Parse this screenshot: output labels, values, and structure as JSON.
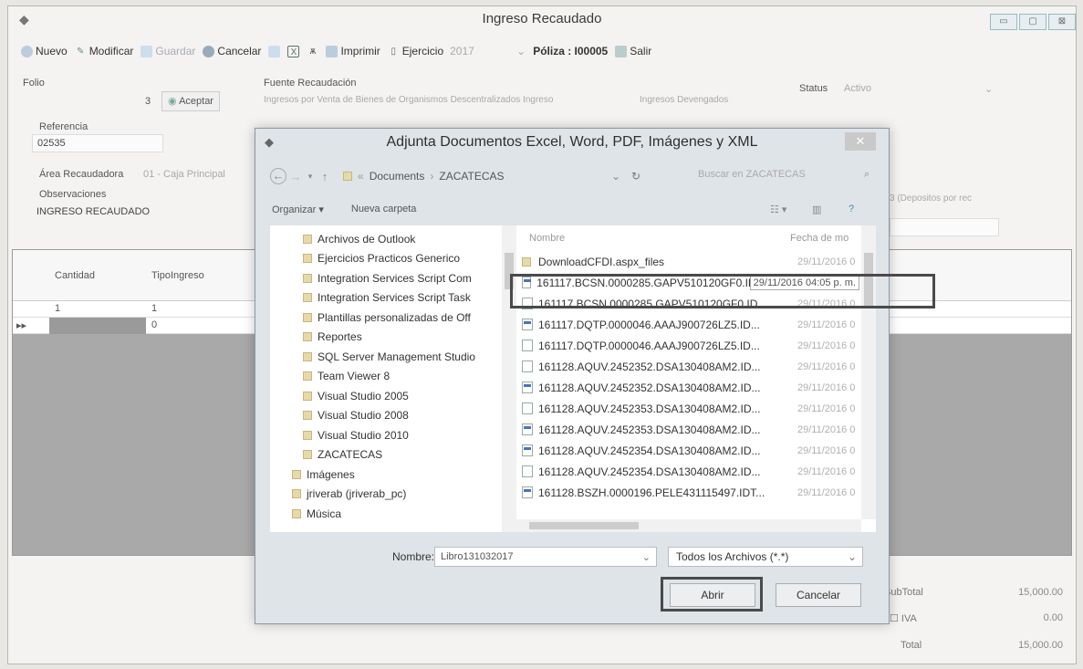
{
  "main": {
    "title": "Ingreso Recaudado",
    "toolbar": {
      "nuevo": "Nuevo",
      "modificar": "Modificar",
      "guardar": "Guardar",
      "cancelar": "Cancelar",
      "imprimir": "Imprimir",
      "ejercicio_label": "Ejercicio",
      "ejercicio_value": "2017",
      "poliza": "Póliza : I00005",
      "salir": "Salir"
    },
    "folio_label": "Folio",
    "folio_value": "3",
    "aceptar": "Aceptar",
    "fuente_label": "Fuente Recaudación",
    "fuente_value": "Ingresos por Venta de Bienes de Organismos Descentralizados Ingreso",
    "ingresos_devengados": "Ingresos Devengados",
    "status_label": "Status",
    "status_value": "Activo",
    "referencia_label": "Referencia",
    "referencia_value": "02535",
    "area_label": "Área Recaudadora",
    "area_value": "01 - Caja Principal",
    "observaciones_label": "Observaciones",
    "observaciones_value": "INGRESO RECAUDADO",
    "depositos_partial": "3 (Depositos por rec",
    "ref_partial": "02535",
    "grid": {
      "col_cantidad": "Cantidad",
      "col_tipo": "TipoIngreso",
      "row1": {
        "cantidad": "1",
        "tipo": "1"
      },
      "row2": {
        "marker": "▸▸",
        "tipo": "0"
      }
    },
    "totals": {
      "subtotal_label": "SubTotal",
      "subtotal_value": "15,000.00",
      "iva_label": "IVA",
      "iva_value": "0.00",
      "total_label": "Total",
      "total_value": "15,000.00"
    }
  },
  "dialog": {
    "title": "Adjunta Documentos Excel, Word, PDF, Imágenes y XML",
    "close": "✕",
    "breadcrumb": [
      "Documents",
      "ZACATECAS"
    ],
    "search_placeholder": "Buscar en ZACATECAS",
    "organize": "Organizar ▾",
    "new_folder": "Nueva carpeta",
    "nav_items": [
      "Archivos de Outlook",
      "Ejercicios Practicos Generico",
      "Integration Services Script Com",
      "Integration Services Script Task",
      "Plantillas personalizadas de Off",
      "Reportes",
      "SQL Server Management Studio",
      "Team Viewer 8",
      "Visual Studio 2005",
      "Visual Studio 2008",
      "Visual Studio 2010",
      "ZACATECAS",
      "Imágenes",
      "jriverab (jriverab_pc)",
      "Música"
    ],
    "col_nombre": "Nombre",
    "col_fecha": "Fecha de mo",
    "files": [
      {
        "name": "DownloadCFDI.aspx_files",
        "date": "29/11/2016 0",
        "type": "folder"
      },
      {
        "name": "161117.BCSN.0000285.GAPV510120GF0.ID...",
        "date": "29/11/2016 04:05 p. m.",
        "type": "pdf"
      },
      {
        "name": "161117.BCSN.0000285.GAPV510120GF0.ID...",
        "date": "29/11/2016 0",
        "type": "xml"
      },
      {
        "name": "161117.DQTP.0000046.AAAJ900726LZ5.ID...",
        "date": "29/11/2016 0",
        "type": "pdf"
      },
      {
        "name": "161117.DQTP.0000046.AAAJ900726LZ5.ID...",
        "date": "29/11/2016 0",
        "type": "xml"
      },
      {
        "name": "161128.AQUV.2452352.DSA130408AM2.ID...",
        "date": "29/11/2016 0",
        "type": "xml"
      },
      {
        "name": "161128.AQUV.2452352.DSA130408AM2.ID...",
        "date": "29/11/2016 0",
        "type": "pdf"
      },
      {
        "name": "161128.AQUV.2452353.DSA130408AM2.ID...",
        "date": "29/11/2016 0",
        "type": "xml"
      },
      {
        "name": "161128.AQUV.2452353.DSA130408AM2.ID...",
        "date": "29/11/2016 0",
        "type": "pdf"
      },
      {
        "name": "161128.AQUV.2452354.DSA130408AM2.ID...",
        "date": "29/11/2016 0",
        "type": "pdf"
      },
      {
        "name": "161128.AQUV.2452354.DSA130408AM2.ID...",
        "date": "29/11/2016 0",
        "type": "xml"
      },
      {
        "name": "161128.BSZH.0000196.PELE431115497.IDT...",
        "date": "29/11/2016 0",
        "type": "pdf"
      }
    ],
    "filename_label": "Nombre:",
    "filename_value": "Libro131032017",
    "filter_value": "Todos los Archivos (*.*)",
    "open_button": "Abrir",
    "cancel_button": "Cancelar"
  }
}
